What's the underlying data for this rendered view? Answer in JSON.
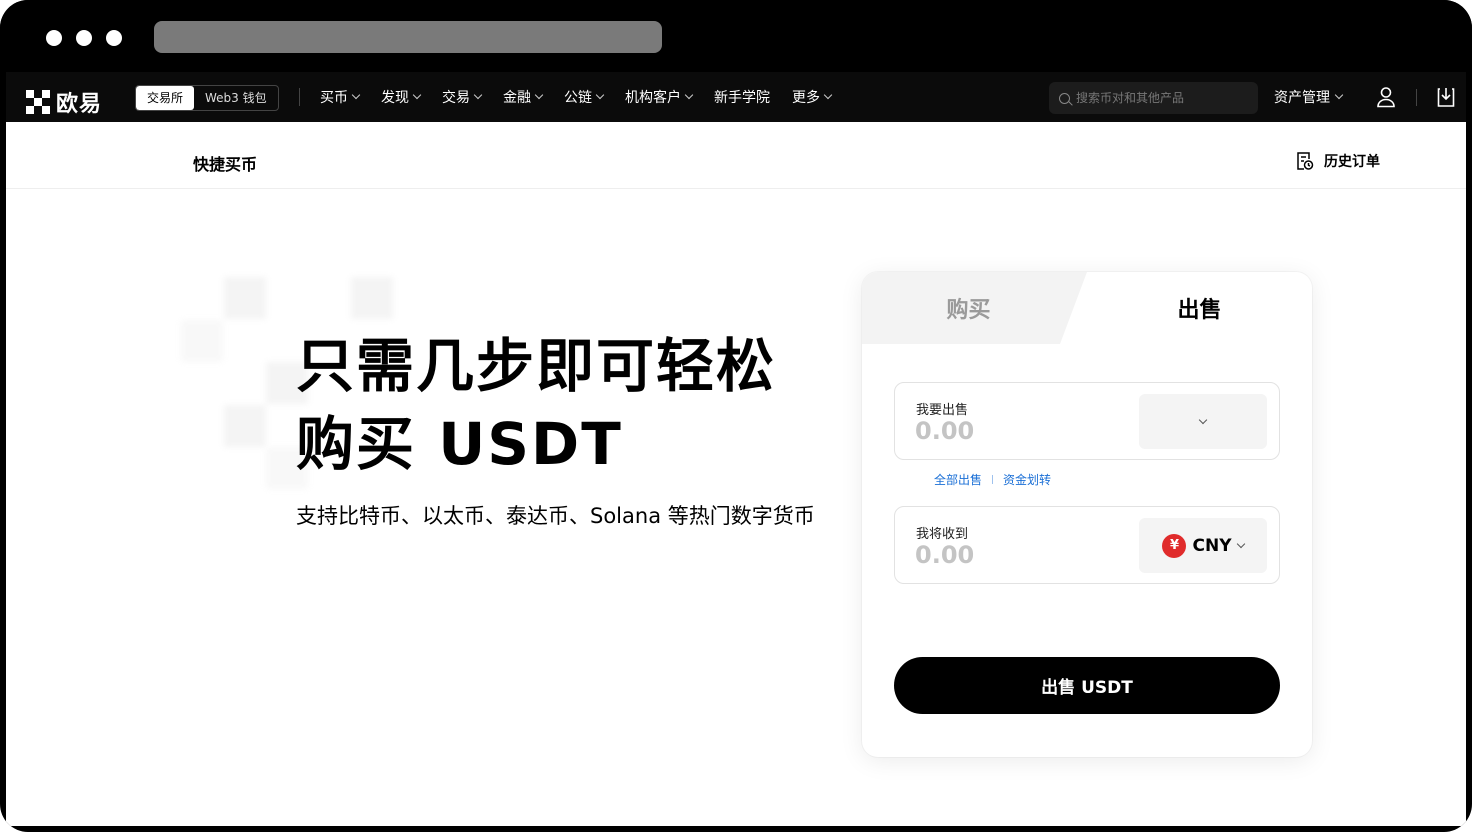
{
  "browser": {},
  "nav": {
    "logo_text": "欧易",
    "segment": {
      "exchange": "交易所",
      "web3": "Web3 钱包"
    },
    "items": [
      {
        "label": "买币",
        "has_dropdown": true
      },
      {
        "label": "发现",
        "has_dropdown": true
      },
      {
        "label": "交易",
        "has_dropdown": true
      },
      {
        "label": "金融",
        "has_dropdown": true
      },
      {
        "label": "公链",
        "has_dropdown": true
      },
      {
        "label": "机构客户",
        "has_dropdown": true
      },
      {
        "label": "新手学院",
        "has_dropdown": false
      },
      {
        "label": "更多",
        "has_dropdown": true
      }
    ],
    "search_placeholder": "搜索币对和其他产品",
    "asset_management": "资产管理"
  },
  "subheader": {
    "title": "快捷买币",
    "history": "历史订单"
  },
  "hero": {
    "title_line1": "只需几步即可轻松",
    "title_line2": "购买 USDT",
    "description": "支持比特币、以太币、泰达币、Solana 等热门数字货币"
  },
  "card": {
    "tabs": {
      "buy": "购买",
      "sell": "出售"
    },
    "active_tab": "sell",
    "sell_field": {
      "label": "我要出售",
      "placeholder": "0.00"
    },
    "receive_field": {
      "label": "我将收到",
      "placeholder": "0.00",
      "currency_symbol": "¥",
      "currency": "CNY"
    },
    "links": {
      "sell_all": "全部出售",
      "transfer": "资金划转"
    },
    "submit": "出售 USDT"
  },
  "colors": {
    "accent_link": "#1a6fd6",
    "cny_badge": "#e02b2b",
    "nav_bg": "#0b0b0b"
  }
}
